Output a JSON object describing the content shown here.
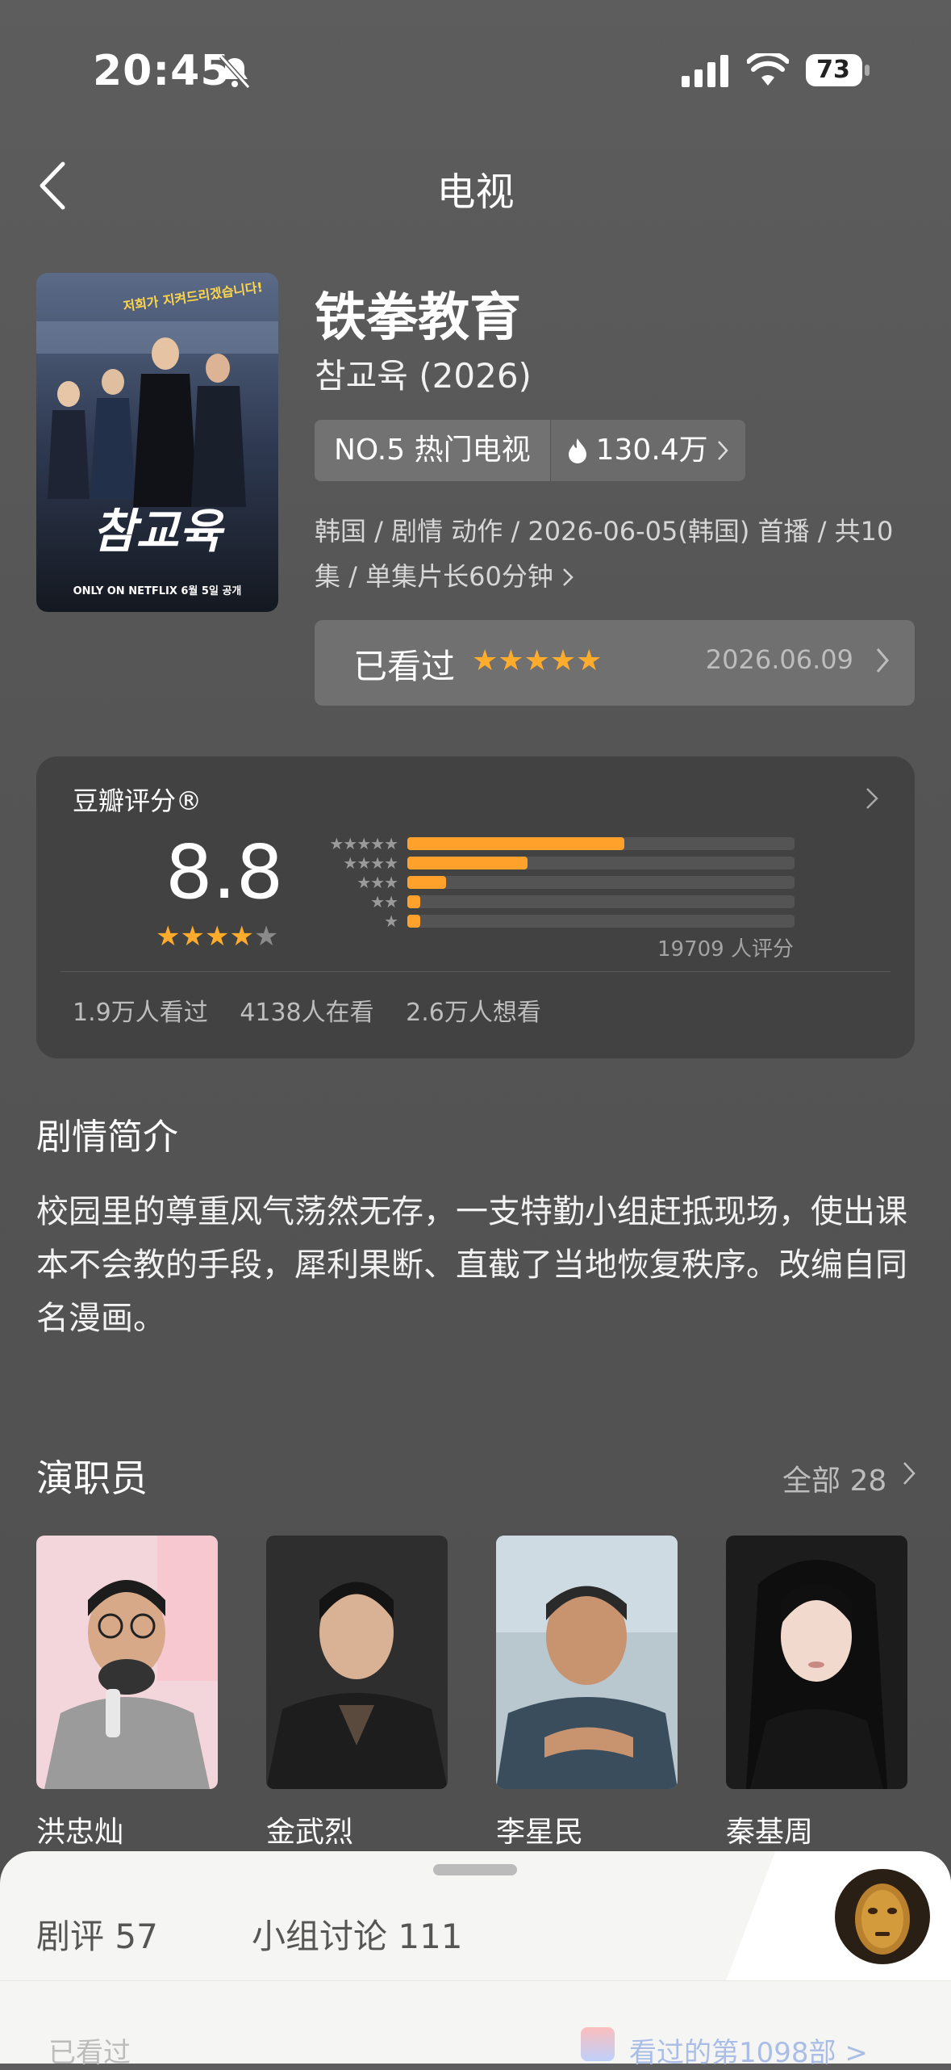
{
  "status_bar": {
    "time": "20:45",
    "battery": "73"
  },
  "nav": {
    "title": "电视"
  },
  "show": {
    "title": "铁拳教育",
    "original_title": "참교육 (2026)",
    "rank_label": "NO.5 热门电视",
    "heat": "130.4万",
    "meta": "韩国 / 剧情 动作 / 2026-06-05(韩国) 首播 / 共10集 / 单集片长60分钟",
    "poster_text": "참교육",
    "poster_top_text": "저희가 지켜드리겠습니다!",
    "poster_footer": "ONLY ON NETFLIX  6월 5일 공개"
  },
  "watched": {
    "label": "已看过",
    "stars": "★★★★★",
    "date": "2026.06.09"
  },
  "rating": {
    "label": "豆瓣评分®",
    "score": "8.8",
    "stars": "★★★★",
    "half_star": "★",
    "count": "19709 人评分",
    "distribution": [
      {
        "stars": "★★★★★",
        "pct": 56
      },
      {
        "stars": "★★★★",
        "pct": 31
      },
      {
        "stars": "★★★",
        "pct": 10
      },
      {
        "stars": "★★",
        "pct": 3
      },
      {
        "stars": "★",
        "pct": 3
      }
    ],
    "stats": {
      "watched": "1.9万人看过",
      "watching": "4138人在看",
      "want": "2.6万人想看"
    }
  },
  "synopsis": {
    "title": "剧情简介",
    "text": "校园里的尊重风气荡然无存，一支特勤小组赶抵现场，使出课本不会教的手段，犀利果断、直截了当地恢复秩序。改编自同名漫画。"
  },
  "cast": {
    "title": "演职员",
    "all_label": "全部 28",
    "members": [
      {
        "name": "洪忠灿"
      },
      {
        "name": "金武烈"
      },
      {
        "name": "李星民"
      },
      {
        "name": "秦基周"
      }
    ]
  },
  "bottom_sheet": {
    "tab_reviews": "剧评 57",
    "tab_groups": "小组讨论 111",
    "faint_left": "已看过",
    "faint_right": "看过的第1098部 >"
  },
  "colors": {
    "accent": "#ffa12b",
    "card": "#424242",
    "sheet": "#f5f5f3"
  }
}
